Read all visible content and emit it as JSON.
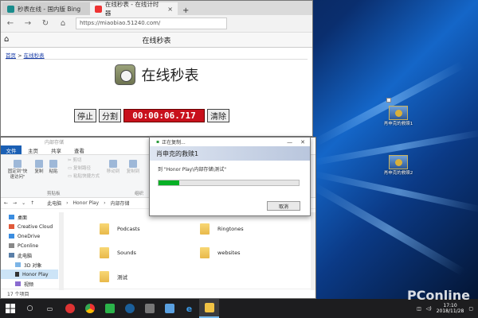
{
  "browser": {
    "tabs": [
      {
        "label": "秒表在线 - 国内版 Bing",
        "active": false
      },
      {
        "label": "在线秒表 - 在线计时器",
        "active": true
      }
    ],
    "url": "https://miaobiao.51240.com/",
    "site_header": "在线秒表",
    "breadcrumb": {
      "home": "首页",
      "sep": " > ",
      "current": "在线秒表"
    },
    "stopwatch": {
      "title": "在线秒表",
      "stop_label": "停止",
      "lap_label": "分割",
      "time": "00:00:06.717",
      "clear_label": "清除"
    }
  },
  "desktop_icons": [
    {
      "label": "肖申克的救赎1"
    },
    {
      "label": "肖申克的救赎2"
    }
  ],
  "explorer": {
    "title": "内部存储",
    "tabs": [
      "文件",
      "主页",
      "共享",
      "查看"
    ],
    "ribbon": {
      "pin": "固定到\"快\n速访问\"",
      "copy": "复制",
      "paste": "粘贴",
      "cut": "剪切",
      "copy_path": "复制路径",
      "paste_shortcut": "粘贴快捷方式",
      "move_to": "移动到",
      "copy_to": "复制到",
      "clipboard_group": "剪贴板",
      "organize_group": "组织"
    },
    "path": [
      "此电脑",
      "Honor Play",
      "内部存储"
    ],
    "nav": [
      {
        "label": "桌面",
        "icon": "blue"
      },
      {
        "label": "Creative Cloud",
        "icon": "cloud"
      },
      {
        "label": "OneDrive",
        "icon": "cloud"
      },
      {
        "label": "PConline",
        "icon": "user"
      },
      {
        "label": "此电脑",
        "icon": "pc"
      },
      {
        "label": "3D 对象",
        "icon": "folder"
      },
      {
        "label": "Honor Play",
        "icon": "phone",
        "selected": true
      },
      {
        "label": "视频",
        "icon": "folder"
      }
    ],
    "folders": [
      "Podcasts",
      "Ringtones",
      "Sounds",
      "websites",
      "测试"
    ],
    "status": "17 个项目"
  },
  "copy_dialog": {
    "title": "正在复制...",
    "heading": "肖申克的救赎1",
    "line": "到 \"Honor Play\\内部存储\\测试\"",
    "progress": 0.15,
    "cancel_label": "取消"
  },
  "taskbar": {
    "clock_time": "17:10",
    "clock_date": "2018/11/28"
  },
  "watermark": "PConline"
}
